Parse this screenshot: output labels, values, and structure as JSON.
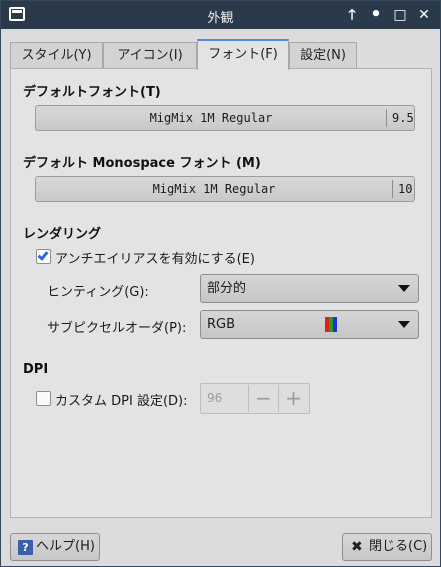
{
  "window": {
    "title": "外観",
    "controls": {
      "keep_above": "🡑",
      "minimize": "•",
      "maximize": "□",
      "close": "✕"
    }
  },
  "tabs": [
    {
      "label": "スタイル(Y)",
      "active": false
    },
    {
      "label": "アイコン(I)",
      "active": false
    },
    {
      "label": "フォント(F)",
      "active": true
    },
    {
      "label": "設定(N)",
      "active": false
    }
  ],
  "default_font": {
    "heading": "デフォルトフォント(T)",
    "name": "MigMix 1M Regular",
    "size": "9.5"
  },
  "mono_font": {
    "heading": "デフォルト Monospace フォント (M)",
    "name": "MigMix 1M Regular",
    "size": "10"
  },
  "rendering": {
    "heading": "レンダリング",
    "antialias_label": "アンチエイリアスを有効にする(E)",
    "antialias_checked": true,
    "hinting_label": "ヒンティング(G):",
    "hinting_value": "部分的",
    "subpixel_label": "サブピクセルオーダ(P):",
    "subpixel_value": "RGB",
    "subpixel_colors": [
      "#e02020",
      "#20a020",
      "#2030e0"
    ]
  },
  "dpi": {
    "heading": "DPI",
    "custom_label": "カスタム DPI 設定(D):",
    "custom_checked": false,
    "value": "96",
    "decrement": "−",
    "increment": "+"
  },
  "buttons": {
    "help_icon": "?",
    "help": "ヘルプ(H)",
    "close_icon": "✖",
    "close": "閉じる(C)"
  }
}
